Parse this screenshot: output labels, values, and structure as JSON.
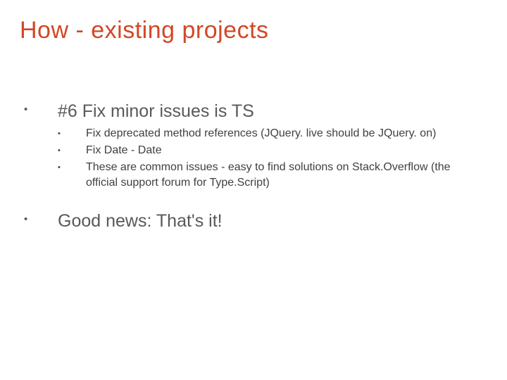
{
  "title": "How - existing projects",
  "items": [
    {
      "text": "#6 Fix minor issues is TS",
      "sub": [
        "Fix deprecated method references (JQuery. live should be JQuery. on)",
        "Fix Date - Date",
        "These are common issues - easy to find solutions on Stack.Overflow (the official support forum for Type.Script)"
      ]
    },
    {
      "text": "Good news: That's it!",
      "sub": []
    }
  ]
}
